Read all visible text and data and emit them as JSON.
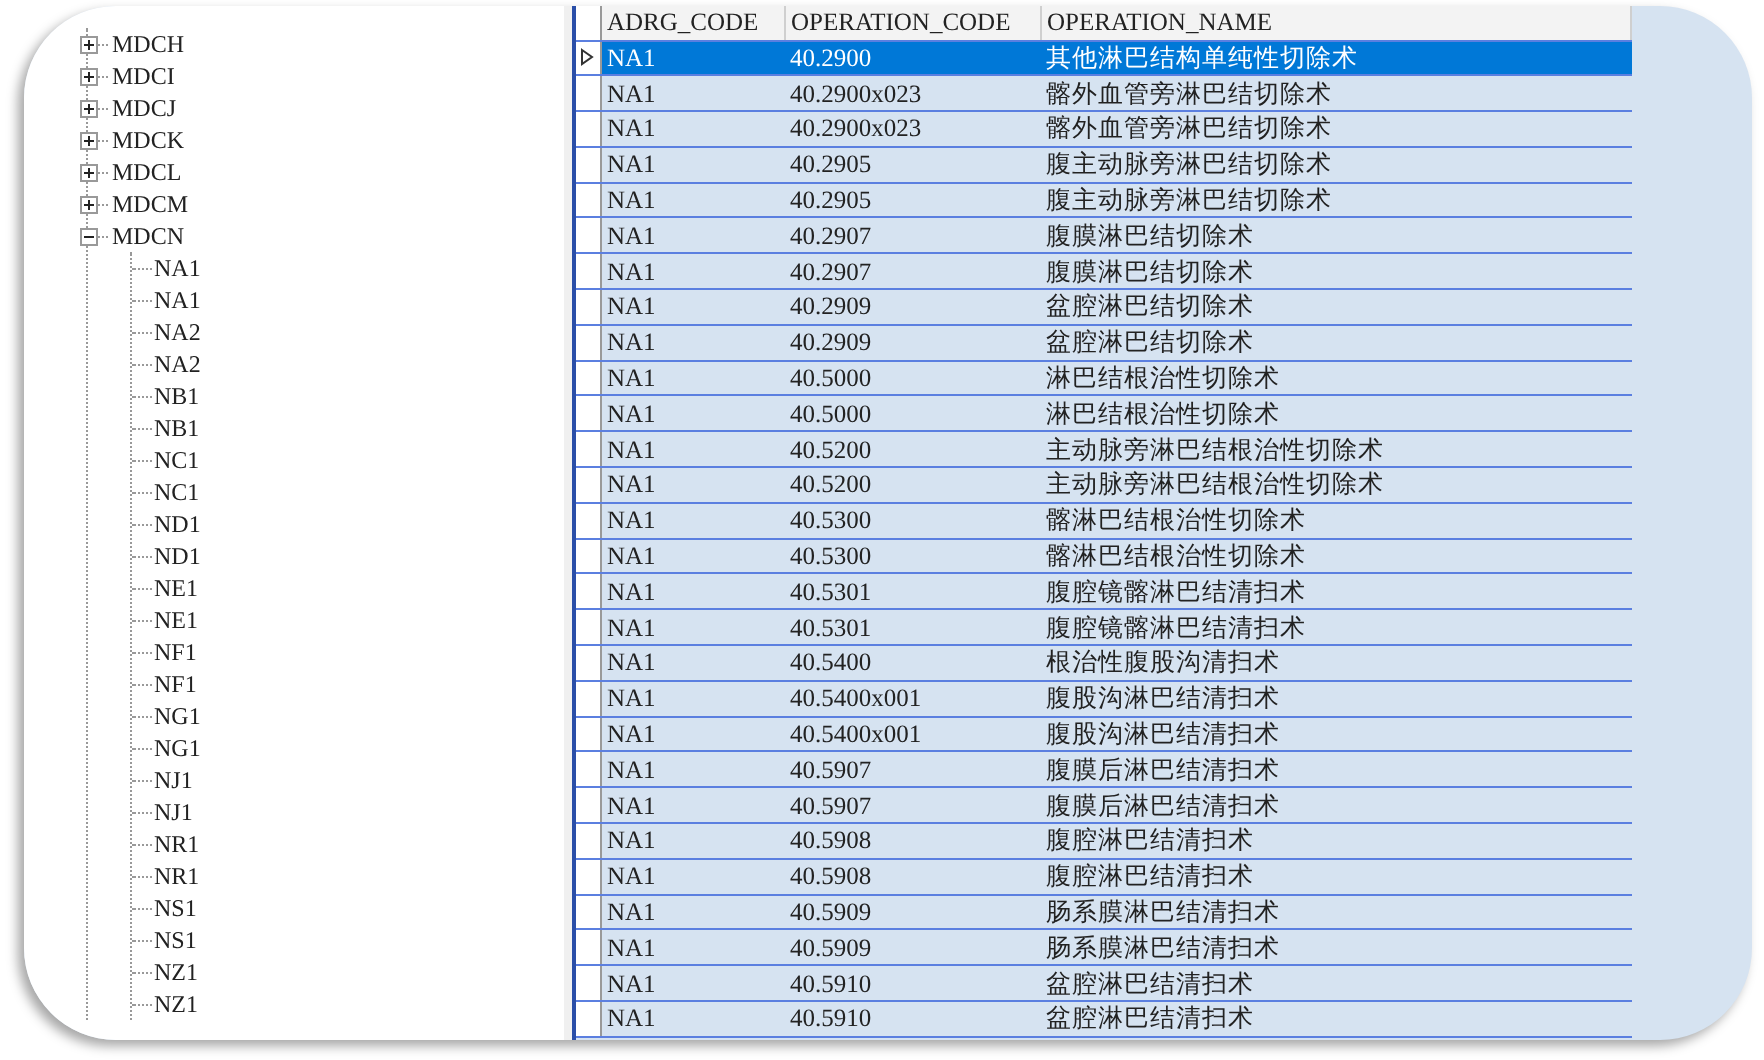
{
  "tree": {
    "items": [
      {
        "label": "MDCH",
        "expanded": false
      },
      {
        "label": "MDCI",
        "expanded": false
      },
      {
        "label": "MDCJ",
        "expanded": false
      },
      {
        "label": "MDCK",
        "expanded": false
      },
      {
        "label": "MDCL",
        "expanded": false
      },
      {
        "label": "MDCM",
        "expanded": false
      },
      {
        "label": "MDCN",
        "expanded": true,
        "children": [
          {
            "label": "NA1"
          },
          {
            "label": "NA1"
          },
          {
            "label": "NA2"
          },
          {
            "label": "NA2"
          },
          {
            "label": "NB1"
          },
          {
            "label": "NB1"
          },
          {
            "label": "NC1"
          },
          {
            "label": "NC1"
          },
          {
            "label": "ND1"
          },
          {
            "label": "ND1"
          },
          {
            "label": "NE1"
          },
          {
            "label": "NE1"
          },
          {
            "label": "NF1"
          },
          {
            "label": "NF1"
          },
          {
            "label": "NG1"
          },
          {
            "label": "NG1"
          },
          {
            "label": "NJ1"
          },
          {
            "label": "NJ1"
          },
          {
            "label": "NR1"
          },
          {
            "label": "NR1"
          },
          {
            "label": "NS1"
          },
          {
            "label": "NS1"
          },
          {
            "label": "NZ1"
          },
          {
            "label": "NZ1"
          }
        ]
      }
    ]
  },
  "grid": {
    "columns": [
      "ADRG_CODE",
      "OPERATION_CODE",
      "OPERATION_NAME"
    ],
    "rows": [
      {
        "selected": true,
        "cells": [
          "NA1",
          "40.2900",
          "其他淋巴结构单纯性切除术"
        ]
      },
      {
        "selected": false,
        "cells": [
          "NA1",
          "40.2900x023",
          "髂外血管旁淋巴结切除术"
        ]
      },
      {
        "selected": false,
        "cells": [
          "NA1",
          "40.2900x023",
          "髂外血管旁淋巴结切除术"
        ]
      },
      {
        "selected": false,
        "cells": [
          "NA1",
          "40.2905",
          "腹主动脉旁淋巴结切除术"
        ]
      },
      {
        "selected": false,
        "cells": [
          "NA1",
          "40.2905",
          "腹主动脉旁淋巴结切除术"
        ]
      },
      {
        "selected": false,
        "cells": [
          "NA1",
          "40.2907",
          "腹膜淋巴结切除术"
        ]
      },
      {
        "selected": false,
        "cells": [
          "NA1",
          "40.2907",
          "腹膜淋巴结切除术"
        ]
      },
      {
        "selected": false,
        "cells": [
          "NA1",
          "40.2909",
          "盆腔淋巴结切除术"
        ]
      },
      {
        "selected": false,
        "cells": [
          "NA1",
          "40.2909",
          "盆腔淋巴结切除术"
        ]
      },
      {
        "selected": false,
        "cells": [
          "NA1",
          "40.5000",
          "淋巴结根治性切除术"
        ]
      },
      {
        "selected": false,
        "cells": [
          "NA1",
          "40.5000",
          "淋巴结根治性切除术"
        ]
      },
      {
        "selected": false,
        "cells": [
          "NA1",
          "40.5200",
          "主动脉旁淋巴结根治性切除术"
        ]
      },
      {
        "selected": false,
        "cells": [
          "NA1",
          "40.5200",
          "主动脉旁淋巴结根治性切除术"
        ]
      },
      {
        "selected": false,
        "cells": [
          "NA1",
          "40.5300",
          "髂淋巴结根治性切除术"
        ]
      },
      {
        "selected": false,
        "cells": [
          "NA1",
          "40.5300",
          "髂淋巴结根治性切除术"
        ]
      },
      {
        "selected": false,
        "cells": [
          "NA1",
          "40.5301",
          "腹腔镜髂淋巴结清扫术"
        ]
      },
      {
        "selected": false,
        "cells": [
          "NA1",
          "40.5301",
          "腹腔镜髂淋巴结清扫术"
        ]
      },
      {
        "selected": false,
        "cells": [
          "NA1",
          "40.5400",
          "根治性腹股沟清扫术"
        ]
      },
      {
        "selected": false,
        "cells": [
          "NA1",
          "40.5400x001",
          "腹股沟淋巴结清扫术"
        ]
      },
      {
        "selected": false,
        "cells": [
          "NA1",
          "40.5400x001",
          "腹股沟淋巴结清扫术"
        ]
      },
      {
        "selected": false,
        "cells": [
          "NA1",
          "40.5907",
          "腹膜后淋巴结清扫术"
        ]
      },
      {
        "selected": false,
        "cells": [
          "NA1",
          "40.5907",
          "腹膜后淋巴结清扫术"
        ]
      },
      {
        "selected": false,
        "cells": [
          "NA1",
          "40.5908",
          "腹腔淋巴结清扫术"
        ]
      },
      {
        "selected": false,
        "cells": [
          "NA1",
          "40.5908",
          "腹腔淋巴结清扫术"
        ]
      },
      {
        "selected": false,
        "cells": [
          "NA1",
          "40.5909",
          "肠系膜淋巴结清扫术"
        ]
      },
      {
        "selected": false,
        "cells": [
          "NA1",
          "40.5909",
          "肠系膜淋巴结清扫术"
        ]
      },
      {
        "selected": false,
        "cells": [
          "NA1",
          "40.5910",
          "盆腔淋巴结清扫术"
        ]
      },
      {
        "selected": false,
        "cells": [
          "NA1",
          "40.5910",
          "盆腔淋巴结清扫术"
        ]
      }
    ]
  }
}
